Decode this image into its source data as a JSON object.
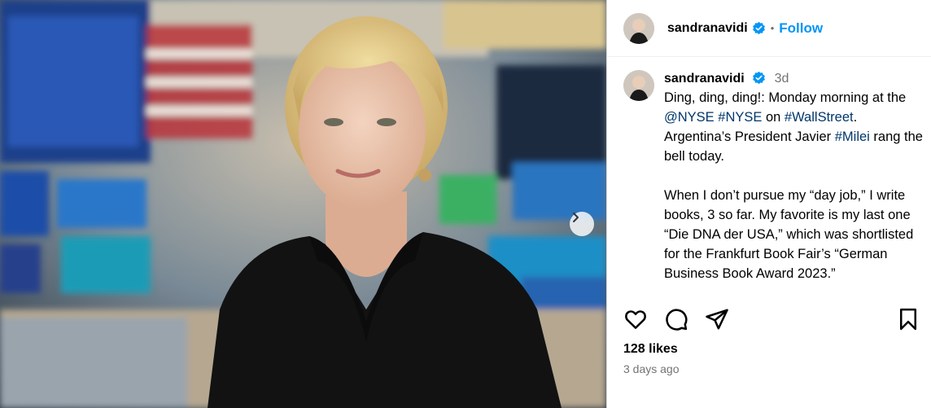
{
  "post": {
    "username": "sandranavidi",
    "follow_label": "Follow",
    "separator": "•"
  },
  "caption": {
    "username": "sandranavidi",
    "time": "3d",
    "para1": {
      "t1": "Ding, ding, ding!: Monday morning at the ",
      "link1": "@NYSE",
      "t2": " ",
      "link2": "#NYSE",
      "t3": " on ",
      "link3": "#WallStreet",
      "t4": ". Argentina’s President Javier ",
      "link4": "#Milei",
      "t5": " rang the bell today."
    },
    "para2": "When I don’t pursue my “day job,” I write books, 3 so far. My favorite is my last one “Die DNA der USA,” which was shortlisted for the Frankfurt Book Fair’s “German Business Book Award 2023.”"
  },
  "stats": {
    "likes": "128 likes",
    "posted": "3 days ago"
  },
  "icons": {
    "like": "heart-icon",
    "comment": "comment-icon",
    "share": "paper-plane-icon",
    "save": "bookmark-icon",
    "verified": "verified-badge-icon",
    "next": "chevron-right-icon"
  },
  "colors": {
    "link": "#00376b",
    "follow": "#0095f6",
    "verified": "#0095f6",
    "muted": "#737373"
  }
}
